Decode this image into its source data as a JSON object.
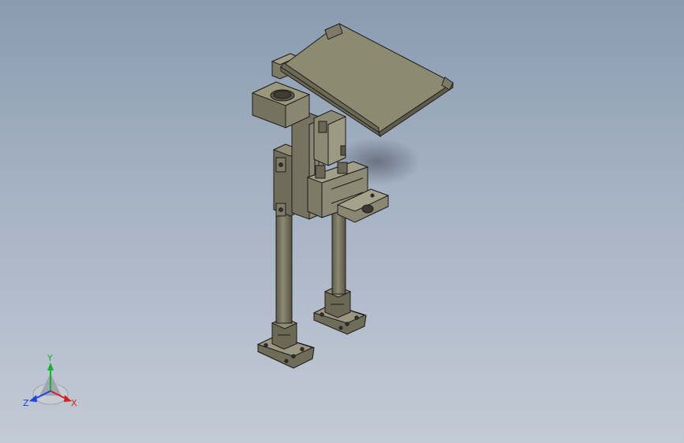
{
  "viewport": {
    "background_top": "#8a9bb0",
    "background_bottom": "#c3cad5"
  },
  "model": {
    "body_color": "#7d7a66",
    "edge_color": "#1e1e1e"
  },
  "triad": {
    "x_label": "X",
    "y_label": "Y",
    "z_label": "Z",
    "x_color": "#d42020",
    "y_color": "#18b030",
    "z_color": "#2040e0"
  }
}
